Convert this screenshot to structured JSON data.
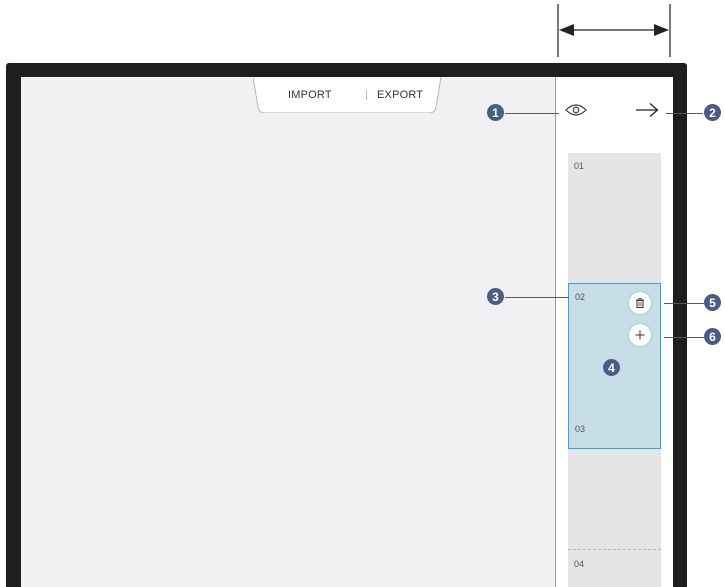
{
  "toolbar": {
    "import_label": "IMPORT",
    "export_label": "EXPORT"
  },
  "pages": [
    "01",
    "02",
    "03",
    "04"
  ],
  "callouts": [
    "1",
    "2",
    "3",
    "4",
    "5",
    "6"
  ],
  "icons": {
    "preview": "eye-icon",
    "next": "arrow-right-icon",
    "delete": "trash-icon",
    "add": "plus-icon"
  },
  "colors": {
    "bezel": "#1e1e1e",
    "screen": "#eff1f3",
    "selected_fill": "#c7dee7",
    "selected_border": "#2fa5dd",
    "callout": "#4a5b88"
  }
}
